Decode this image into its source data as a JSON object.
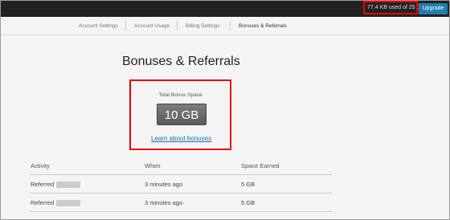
{
  "topbar": {
    "usage_text": "77.4 KB used of 25 GB",
    "upgrade_label": "Upgrade"
  },
  "tabs": [
    {
      "label": "Account Settings",
      "active": false
    },
    {
      "label": "Account Usage",
      "active": false
    },
    {
      "label": "Billing Settings",
      "active": false
    },
    {
      "label": "Bonuses & Referrals",
      "active": true
    }
  ],
  "page": {
    "title": "Bonuses & Referrals"
  },
  "bonus": {
    "caption": "Total Bonus Space",
    "value": "10 GB",
    "learn_link": "Learn about bonuses"
  },
  "table": {
    "headers": [
      "Activity",
      "When",
      "Space Earned"
    ],
    "rows": [
      {
        "activity": "Referred",
        "when": "3 minutes ago",
        "space": "5 GB"
      },
      {
        "activity": "Referred",
        "when": "3 minutes ago",
        "space": "5 GB"
      }
    ]
  },
  "colors": {
    "highlight": "#ee0000",
    "upgrade": "#1f7fae",
    "link": "#1a6fb0"
  }
}
